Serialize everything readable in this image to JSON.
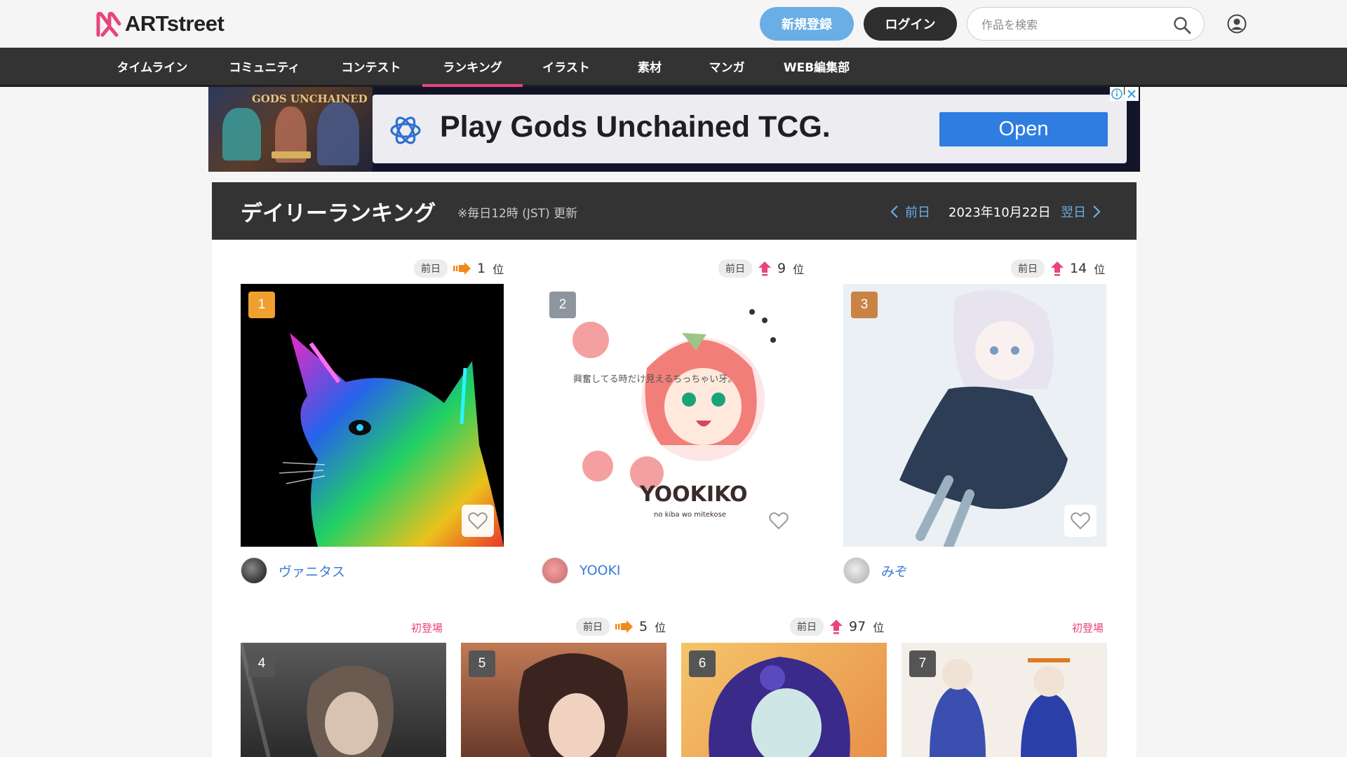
{
  "header": {
    "logo_text": "ARTstreet",
    "register_label": "新規登録",
    "login_label": "ログイン",
    "search_placeholder": "作品を検索"
  },
  "nav": {
    "items": [
      "タイムライン",
      "コミュニティ",
      "コンテスト",
      "ランキング",
      "イラスト",
      "素材",
      "マンガ",
      "WEB編集部"
    ],
    "active": "ランキング"
  },
  "ad": {
    "image_title": "GODS UNCHAINED",
    "headline": "Play Gods Unchained TCG.",
    "open_label": "Open"
  },
  "ranking": {
    "title": "デイリーランキング",
    "note": "※毎日12時 (JST) 更新",
    "prev_label": "前日",
    "date": "2023年10月22日",
    "next_label": "翌日",
    "prev_badge": "前日",
    "pos_suffix": "位",
    "first_appearance": "初登場",
    "top_items": [
      {
        "rank": "1",
        "prev_rank": "1",
        "trend": "same",
        "author": "ヴァニタス",
        "badge_color": "#f0a030"
      },
      {
        "rank": "2",
        "prev_rank": "9",
        "trend": "up",
        "author": "YOOKI",
        "badge_color": "#8d969e"
      },
      {
        "rank": "3",
        "prev_rank": "14",
        "trend": "up",
        "author": "みぞ",
        "badge_color": "#c98345"
      }
    ],
    "second_row": [
      {
        "rank": "4",
        "status": "初登場"
      },
      {
        "rank": "5",
        "prev_rank": "5",
        "trend": "same"
      },
      {
        "rank": "6",
        "prev_rank": "97",
        "trend": "up"
      },
      {
        "rank": "7",
        "status": "初登場"
      }
    ],
    "yooki_art_text": "YOOKIKO",
    "yooki_art_sub": "no kiba wo mitekose",
    "yooki_note": "興奮してる時だけ見えるちっちゃい牙。"
  },
  "colors": {
    "accent_pink": "#e8457a",
    "link_blue": "#3a7bd5",
    "register_blue": "#6aaee6",
    "nav_bg": "#333333"
  }
}
